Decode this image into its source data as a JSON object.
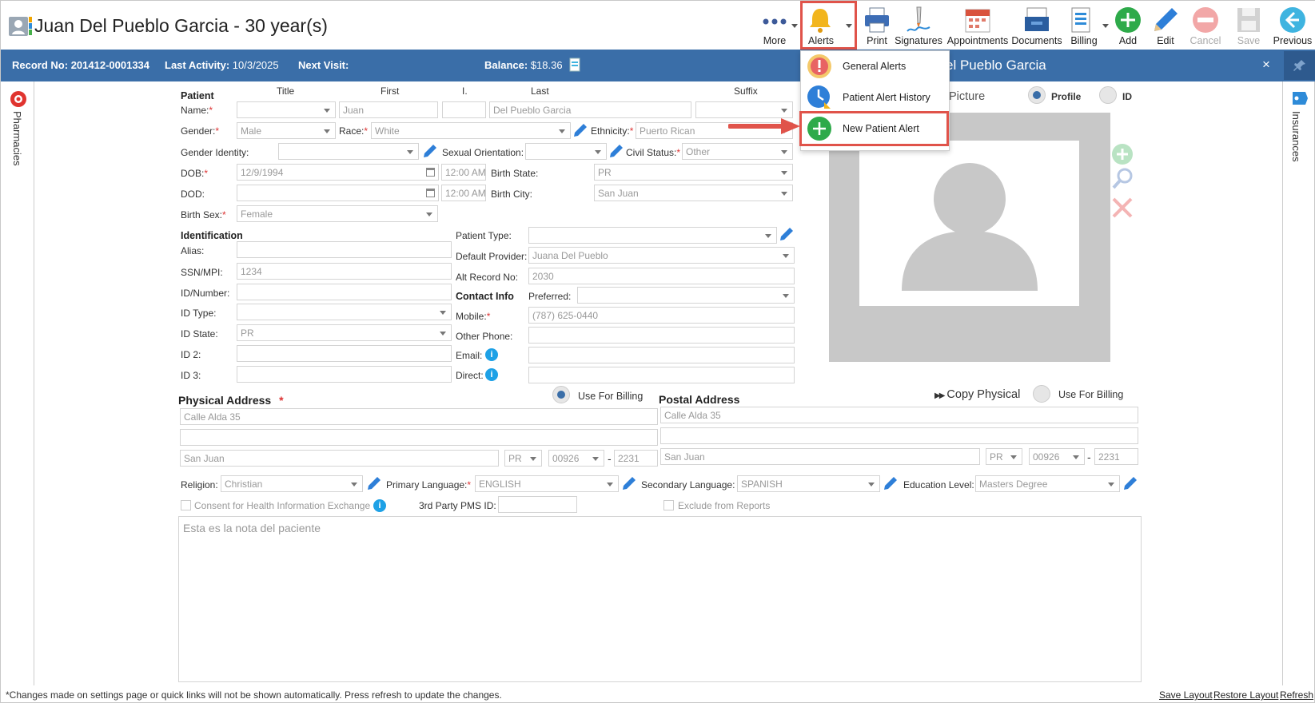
{
  "header": {
    "title": "Juan Del Pueblo Garcia - 30 year(s)",
    "toolbar": {
      "more": "More",
      "alerts": "Alerts",
      "print": "Print",
      "signatures": "Signatures",
      "appointments": "Appointments",
      "documents": "Documents",
      "billing": "Billing",
      "add": "Add",
      "edit": "Edit",
      "cancel": "Cancel",
      "save": "Save",
      "previous": "Previous"
    }
  },
  "infobar": {
    "record_label": "Record No:",
    "record_value": "201412-0001334",
    "activity_label": "Last Activity:",
    "activity_value": "10/3/2025",
    "visit_label": "Next Visit:",
    "visit_value": "",
    "balance_label": "Balance:",
    "balance_value": "$18.36",
    "panel_title": "el Pueblo Garcia",
    "close": "×"
  },
  "side": {
    "left": "Pharmacies",
    "right": "Insurances"
  },
  "alerts_menu": {
    "items": [
      "General Alerts",
      "Patient Alert History",
      "New Patient Alert"
    ]
  },
  "patient": {
    "section": "Patient",
    "col_title": "Title",
    "col_first": "First",
    "col_i": "I.",
    "col_last": "Last",
    "col_suffix": "Suffix",
    "name_label": "Name:",
    "first": "Juan",
    "last": "Del Pueblo Garcia",
    "gender_label": "Gender:",
    "gender": "Male",
    "race_label": "Race:",
    "race": "White",
    "ethnicity_label": "Ethnicity:",
    "ethnicity": "Puerto Rican",
    "gender_identity_label": "Gender Identity:",
    "sexual_orientation_label": "Sexual Orientation:",
    "civil_status_label": "Civil Status:",
    "civil_status": "Other",
    "dob_label": "DOB:",
    "dob": "12/9/1994",
    "dob_time": "12:00 AM",
    "birth_state_label": "Birth State:",
    "birth_state": "PR",
    "dod_label": "DOD:",
    "dod_time": "12:00 AM",
    "birth_city_label": "Birth City:",
    "birth_city": "San Juan",
    "birth_sex_label": "Birth Sex:",
    "birth_sex": "Female"
  },
  "identification": {
    "section": "Identification",
    "alias_label": "Alias:",
    "ssn_label": "SSN/MPI:",
    "ssn": "1234",
    "id_number_label": "ID/Number:",
    "id_type_label": "ID Type:",
    "id_state_label": "ID State:",
    "id_state": "PR",
    "id2_label": "ID 2:",
    "id3_label": "ID 3:",
    "patient_type_label": "Patient Type:",
    "default_provider_label": "Default Provider:",
    "default_provider": "Juana Del Pueblo",
    "alt_record_label": "Alt Record No:",
    "alt_record": "2030"
  },
  "contact": {
    "section": "Contact Info",
    "preferred_label": "Preferred:",
    "mobile_label": "Mobile:",
    "mobile": "(787) 625-0440",
    "other_phone_label": "Other Phone:",
    "email_label": "Email:",
    "direct_label": "Direct:"
  },
  "picture": {
    "label": "Picture",
    "profile": "Profile",
    "id": "ID"
  },
  "physical": {
    "section": "Physical Address",
    "use_billing": "Use For Billing",
    "line1": "Calle Alda 35",
    "city": "San Juan",
    "state": "PR",
    "zip": "00926",
    "zip4": "2231"
  },
  "postal": {
    "section": "Postal Address",
    "copy": "Copy Physical",
    "use_billing": "Use For Billing",
    "line1": "Calle Alda 35",
    "city": "San Juan",
    "state": "PR",
    "zip": "00926",
    "zip4": "2231"
  },
  "misc": {
    "religion_label": "Religion:",
    "religion": "Christian",
    "primary_lang_label": "Primary Language:",
    "primary_lang": "ENGLISH",
    "secondary_lang_label": "Secondary Language:",
    "secondary_lang": "SPANISH",
    "education_label": "Education Level:",
    "education": "Masters Degree",
    "consent_label": "Consent for Health Information Exchange",
    "pms_label": "3rd Party PMS ID:",
    "exclude_label": "Exclude from Reports",
    "notes": "Esta es la nota del paciente",
    "dash": "-"
  },
  "footer": {
    "note": "*Changes made on settings page or quick links will not be shown automatically. Press refresh to update the changes.",
    "save_layout": "Save Layout",
    "restore_layout": "Restore Layout",
    "refresh": "Refresh"
  },
  "colors": {
    "bar": "#3a6ea8",
    "highlight": "#e0534a",
    "add": "#2eaa4a"
  }
}
